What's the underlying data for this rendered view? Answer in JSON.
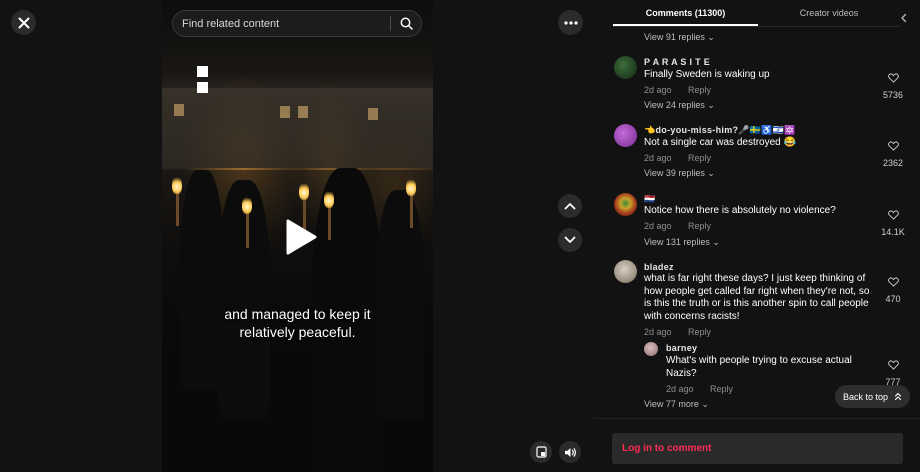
{
  "player": {
    "search": {
      "placeholder": "Find related content"
    },
    "caption_line1": "and managed to keep it",
    "caption_line2": "relatively peaceful.",
    "icons": {
      "close": "close-icon",
      "search": "search-icon",
      "more": "more-icon",
      "nav_up": "chevron-up-icon",
      "nav_down": "chevron-down-icon",
      "play": "play-icon",
      "pip": "picture-in-picture-icon",
      "volume": "volume-icon"
    }
  },
  "tabs": {
    "comments": "Comments (11300)",
    "creator_videos": "Creator videos"
  },
  "comments": [
    {
      "id": "top-replies",
      "view_replies": "View 91 replies"
    },
    {
      "username": "P A R A S I T E",
      "text": "Finally Sweden is waking up",
      "time": "2d ago",
      "reply": "Reply",
      "likes": "5736",
      "view_replies": "View 24 replies",
      "avatar_color": "#1e3b1e"
    },
    {
      "username": "👈do-you-miss-him?🎤🇸🇪♿🇮🇱🔯",
      "text": "Not a single car was destroyed 😂",
      "time": "2d ago",
      "reply": "Reply",
      "likes": "2362",
      "view_replies": "View 39 replies",
      "avatar_color": "#8e3fa8"
    },
    {
      "username": "🇳🇱",
      "text": "Notice how there is absolutely no violence?",
      "time": "2d ago",
      "reply": "Reply",
      "likes": "14.1K",
      "view_replies": "View 131 replies",
      "avatar_color": "#a33a1c"
    },
    {
      "username": "bladez",
      "text": "what is far right these days? I just keep thinking of how people get called far right when they're not, so is this the truth or is this another spin to call people with concerns racists!",
      "time": "2d ago",
      "reply": "Reply",
      "likes": "470",
      "avatar_color": "#9a8f7e",
      "reply_item": {
        "username": "barney",
        "text": "What's with people trying to excuse actual Nazis?",
        "time": "2d ago",
        "reply": "Reply",
        "likes": "777",
        "avatar_color": "#a88a8a"
      },
      "view_replies": "View 77 more"
    }
  ],
  "back_to_top": "Back to top",
  "login_prompt": "Log in to comment",
  "colors": {
    "accent": "#fe2c55",
    "panel_bg": "#121212",
    "muted_text": "#8f8f8f"
  }
}
